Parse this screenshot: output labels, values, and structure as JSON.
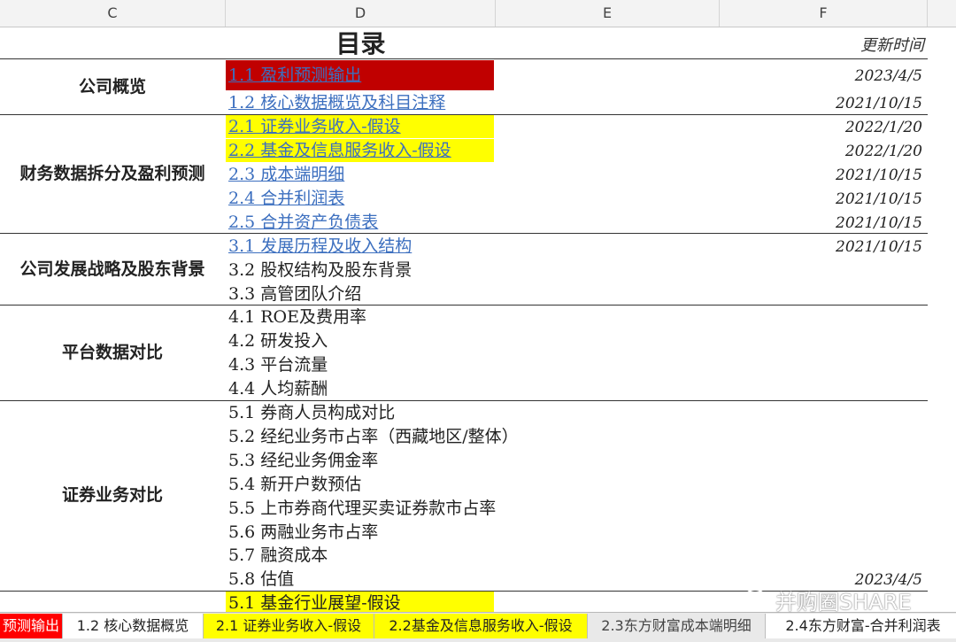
{
  "columns": [
    "C",
    "D",
    "E",
    "F"
  ],
  "header": {
    "title": "目录",
    "update_label": "更新时间"
  },
  "sections": [
    {
      "category": "公司概览",
      "items": [
        {
          "label": "1.1 盈利预测输出",
          "date": "2023/4/5",
          "link": true,
          "highlight": "#c00000"
        },
        {
          "label": "1.2 核心数据概览及科目注释",
          "date": "2021/10/15",
          "link": true
        }
      ]
    },
    {
      "category": "财务数据拆分及盈利预测",
      "items": [
        {
          "label": "2.1 证券业务收入-假设",
          "date": "2022/1/20",
          "link": true,
          "highlight": "#ffff00"
        },
        {
          "label": "2.2 基金及信息服务收入-假设",
          "date": "2022/1/20",
          "link": true,
          "highlight": "#ffff00"
        },
        {
          "label": "2.3 成本端明细",
          "date": "2021/10/15",
          "link": true
        },
        {
          "label": "2.4 合并利润表",
          "date": "2021/10/15",
          "link": true
        },
        {
          "label": "2.5 合并资产负债表",
          "date": "2021/10/15",
          "link": true
        }
      ]
    },
    {
      "category": "公司发展战略及股东背景",
      "items": [
        {
          "label": "3.1 发展历程及收入结构",
          "date": "2021/10/15",
          "link": true
        },
        {
          "label": "3.2 股权结构及股东背景"
        },
        {
          "label": "3.3 高管团队介绍"
        }
      ]
    },
    {
      "category": "平台数据对比",
      "items": [
        {
          "label": "4.1 ROE及费用率"
        },
        {
          "label": "4.2 研发投入"
        },
        {
          "label": "4.3 平台流量"
        },
        {
          "label": "4.4 人均薪酬"
        }
      ]
    },
    {
      "category": "证券业务对比",
      "items": [
        {
          "label": "5.1 券商人员构成对比"
        },
        {
          "label": "5.2 经纪业务市占率（西藏地区/整体）"
        },
        {
          "label": "5.3 经纪业务佣金率"
        },
        {
          "label": "5.4 新开户数预估"
        },
        {
          "label": "5.5 上市券商代理买卖证券款市占率"
        },
        {
          "label": "5.6 两融业务市占率"
        },
        {
          "label": "5.7 融资成本"
        },
        {
          "label": "5.8 估值",
          "date": "2023/4/5"
        }
      ]
    },
    {
      "category": "",
      "items": [
        {
          "label": "5.1 基金行业展望-假设",
          "highlight": "#ffff00"
        }
      ]
    }
  ],
  "tabs": [
    {
      "label": "预测输出",
      "bg": "#ff0000",
      "color": "#ffffff"
    },
    {
      "label": "1.2 核心数据概览",
      "bg": "#ffffff",
      "color": "#222222"
    },
    {
      "label": "2.1 证券业务收入-假设",
      "bg": "#ffff00",
      "color": "#222222"
    },
    {
      "label": "2.2基金及信息服务收入-假设",
      "bg": "#ffff00",
      "color": "#222222"
    },
    {
      "label": "2.3东方财富成本端明细",
      "bg": "#e9e9e9",
      "color": "#444444"
    },
    {
      "label": "2.4东方财富-合并利润表",
      "bg": "#ffffff",
      "color": "#222222"
    }
  ],
  "watermark": "并购圈SHARE",
  "colors": {
    "link": "#3c6fbf",
    "red_fill": "#c00000",
    "yellow_fill": "#ffff00"
  }
}
